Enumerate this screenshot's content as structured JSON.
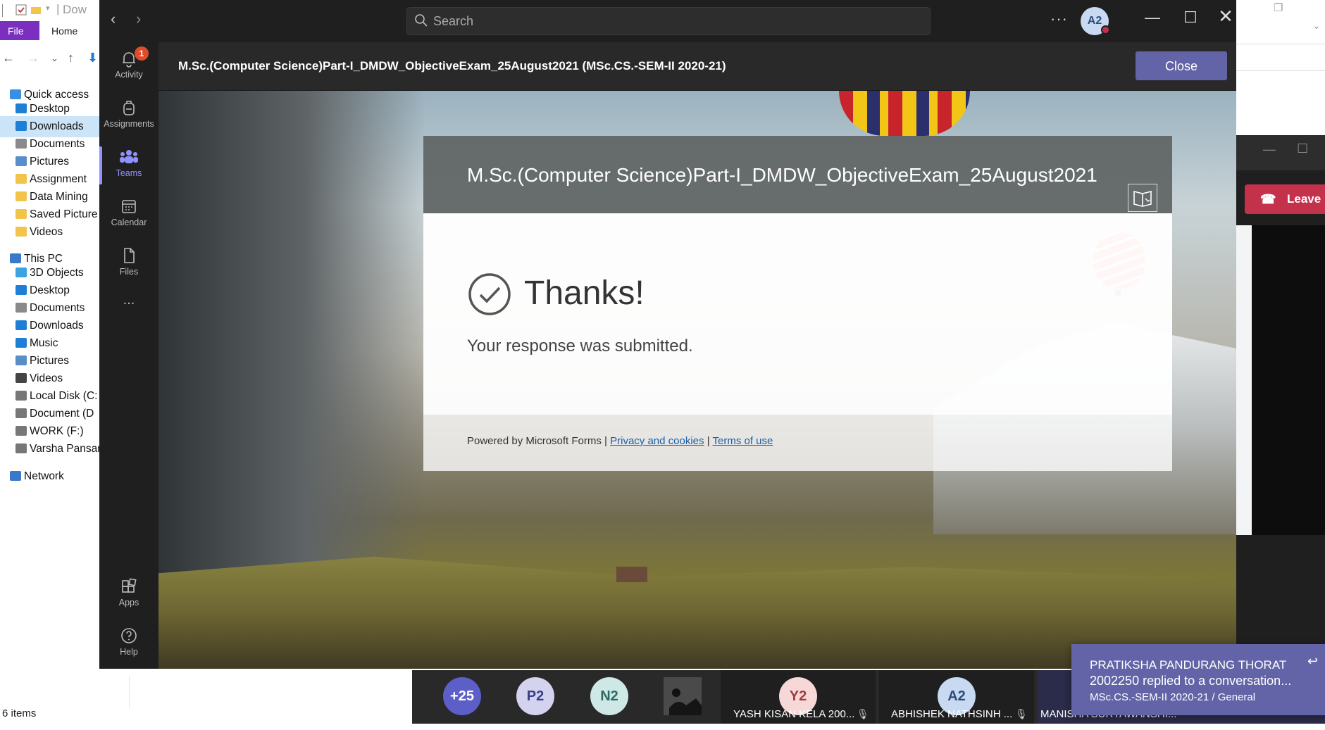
{
  "explorer": {
    "title_fragment": "Dow",
    "ribbon_tabs": [
      "File",
      "Home"
    ],
    "quick_access": {
      "label": "Quick access",
      "items": [
        {
          "label": "Desktop",
          "icon": "desktop-icon",
          "color": "#1e7fd6"
        },
        {
          "label": "Downloads",
          "icon": "downloads-icon",
          "color": "#1e7fd6",
          "selected": true
        },
        {
          "label": "Documents",
          "icon": "documents-icon",
          "color": "#8a8a8a"
        },
        {
          "label": "Pictures",
          "icon": "pictures-icon",
          "color": "#5a8ec9"
        },
        {
          "label": "Assignment",
          "icon": "folder-icon",
          "color": "#f2c44c"
        },
        {
          "label": "Data Mining",
          "icon": "folder-icon",
          "color": "#f2c44c"
        },
        {
          "label": "Saved Picture",
          "icon": "folder-icon",
          "color": "#f2c44c"
        },
        {
          "label": "Videos",
          "icon": "folder-icon",
          "color": "#f2c44c"
        }
      ]
    },
    "this_pc": {
      "label": "This PC",
      "items": [
        {
          "label": "3D Objects",
          "icon": "3d-objects-icon",
          "color": "#3ba3e0"
        },
        {
          "label": "Desktop",
          "icon": "desktop-icon",
          "color": "#1e7fd6"
        },
        {
          "label": "Documents",
          "icon": "documents-icon",
          "color": "#8a8a8a"
        },
        {
          "label": "Downloads",
          "icon": "downloads-icon",
          "color": "#1e7fd6"
        },
        {
          "label": "Music",
          "icon": "music-icon",
          "color": "#1e7fd6"
        },
        {
          "label": "Pictures",
          "icon": "pictures-icon",
          "color": "#5a8ec9"
        },
        {
          "label": "Videos",
          "icon": "videos-icon",
          "color": "#444"
        },
        {
          "label": "Local Disk (C:",
          "icon": "drive-icon",
          "color": "#777"
        },
        {
          "label": "Document (D",
          "icon": "drive-icon",
          "color": "#777"
        },
        {
          "label": "WORK (F:)",
          "icon": "drive-icon",
          "color": "#777"
        },
        {
          "label": "Varsha Pansar",
          "icon": "drive-icon",
          "color": "#777"
        }
      ]
    },
    "network_label": "Network",
    "status": "6 items"
  },
  "teams": {
    "search_placeholder": "Search",
    "user_initials": "A2",
    "rail": [
      {
        "label": "Activity",
        "badge": "1"
      },
      {
        "label": "Assignments"
      },
      {
        "label": "Teams",
        "active": true
      },
      {
        "label": "Calendar"
      },
      {
        "label": "Files"
      },
      {
        "label": "..."
      },
      {
        "label": "Apps"
      },
      {
        "label": "Help"
      }
    ],
    "content_title": "M.Sc.(Computer Science)Part-I_DMDW_ObjectiveExam_25August2021  (MSc.CS.-SEM-II 2020-21)",
    "close_label": "Close"
  },
  "form": {
    "title": "M.Sc.(Computer Science)Part-I_DMDW_ObjectiveExam_25August2021",
    "thanks": "Thanks!",
    "message": "Your response was submitted.",
    "footer_prefix": "Powered by Microsoft Forms | ",
    "privacy_link": "Privacy and cookies",
    "separator": " | ",
    "terms_link": "Terms of use"
  },
  "meeting": {
    "leave_label": "Leave",
    "participants": [
      {
        "initials": "+25",
        "bg": "#5b5fc7",
        "fg": "#ffffff"
      },
      {
        "initials": "P2",
        "bg": "#d3d3ef",
        "fg": "#3b3d86"
      },
      {
        "initials": "N2",
        "bg": "#cde8e5",
        "fg": "#2b6a63"
      }
    ],
    "tiles": [
      {
        "initials": "Y2",
        "name": "YASH KISAN KELA 200...",
        "bg": "#f7d8d8",
        "fg": "#a33b3b"
      },
      {
        "initials": "A2",
        "name": "ABHISHEK NATHSINH ...",
        "bg": "#c7daf2",
        "fg": "#2f4c7c"
      },
      {
        "name": "MANISHA SURYAWANSHI..."
      }
    ]
  },
  "toast": {
    "line1": "PRATIKSHA PANDURANG THORAT",
    "line2": "2002250 replied to a conversation...",
    "line3": "MSc.CS.-SEM-II 2020-21 / General"
  }
}
